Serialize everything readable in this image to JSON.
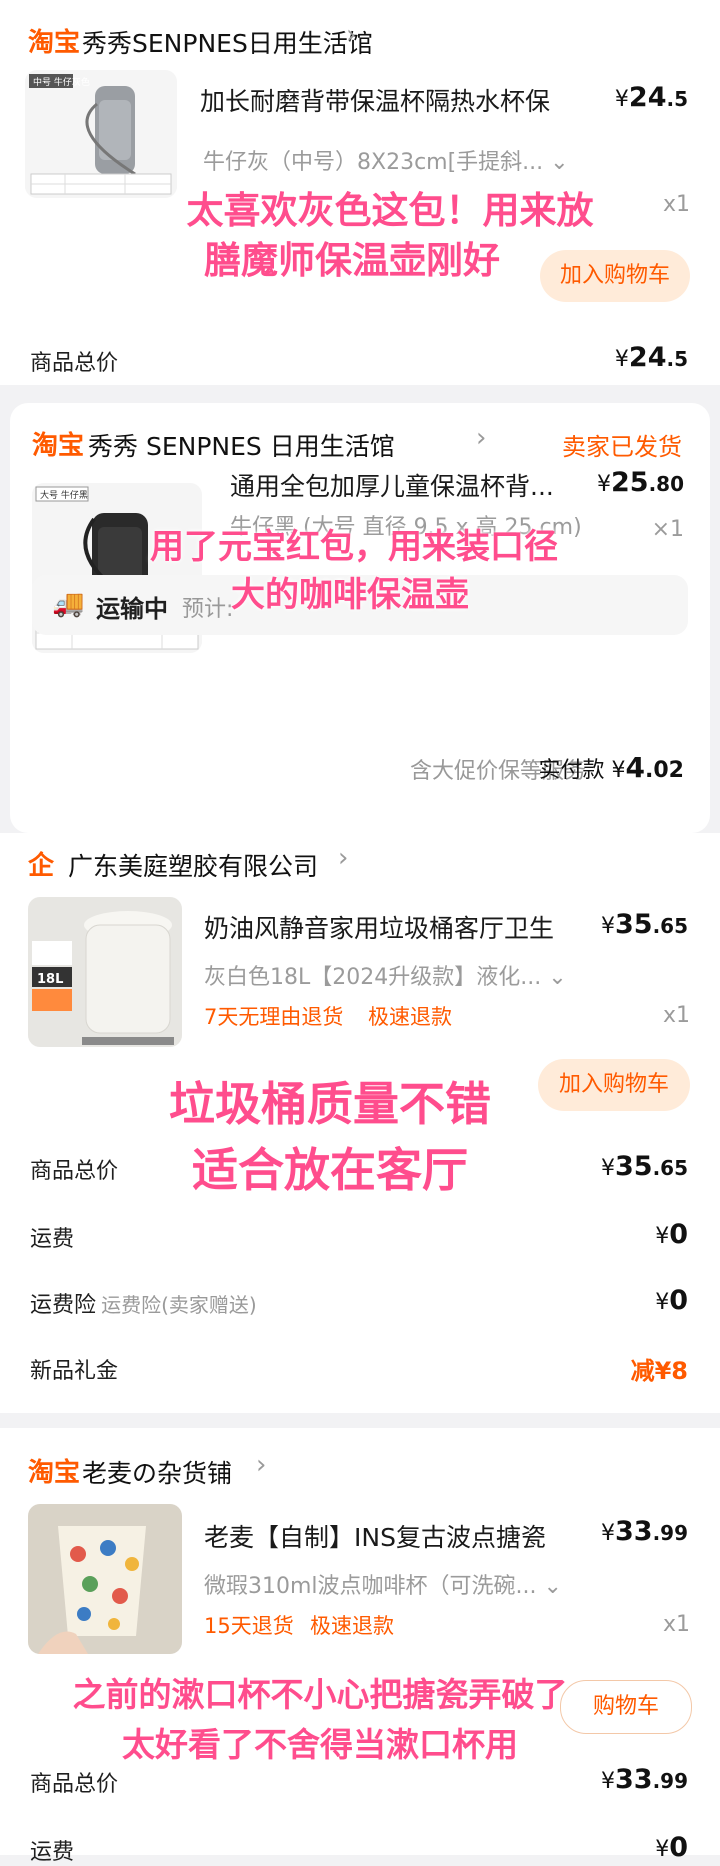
{
  "order1": {
    "store_logo": "淘宝",
    "store_name": "秀秀SENPNES日用生活馆",
    "thumb_badge": "中号 牛仔灰色",
    "title": "加长耐磨背带保温杯隔热水杯保",
    "sku": "牛仔灰（中号）8X23cm[手提斜...",
    "price_symbol": "¥",
    "price_int": "24",
    "price_dec": ".5",
    "qty": "x1",
    "add_cart": "加入购物车",
    "total_label": "商品总价",
    "total_int": "24",
    "total_dec": ".5",
    "overlay_line1": "太喜欢灰色这包！用来放",
    "overlay_line2": "膳魔师保温壶刚好"
  },
  "order2": {
    "store_logo": "淘宝",
    "store_name": "秀秀 SENPNES 日用生活馆",
    "status": "卖家已发货",
    "thumb_badge": "大号 牛仔黑",
    "title": "通用全包加厚儿童保温杯背...",
    "sku": "牛仔黑 (大号 直径 9.5 x 高 25 cm)",
    "price_int": "25",
    "price_dec": ".80",
    "qty": "×1",
    "shipping_status": "运输中",
    "shipping_eta": "预计:",
    "service_note": "含大促价保等服务",
    "paid_label": "实付款",
    "paid_int": "4",
    "paid_dec": ".02",
    "overlay_line1": "用了元宝红包，用来装口径",
    "overlay_line2": "大的咖啡保温壶"
  },
  "order3": {
    "store_logo": "企",
    "store_name": "广东美庭塑胶有限公司",
    "thumb_badge": "18L",
    "title": "奶油风静音家用垃圾桶客厅卫生",
    "sku": "灰白色18L【2024升级款】液化...",
    "price_int": "35",
    "price_dec": ".65",
    "tag1": "7天无理由退货",
    "tag2": "极速退款",
    "qty": "x1",
    "add_cart": "加入购物车",
    "total_label": "商品总价",
    "total_int": "35",
    "total_dec": ".65",
    "shipping_label": "运费",
    "shipping_value": "0",
    "insurance_label": "运费险",
    "insurance_note": "运费险(卖家赠送)",
    "insurance_value": "0",
    "gift_label": "新品礼金",
    "gift_value": "减¥8",
    "overlay_line1": "垃圾桶质量不错",
    "overlay_line2": "适合放在客厅"
  },
  "order4": {
    "store_logo": "淘宝",
    "store_name": "老麦の杂货铺",
    "title": "老麦【自制】INS复古波点搪瓷",
    "sku": "微瑕310ml波点咖啡杯（可洗碗...",
    "price_int": "33",
    "price_dec": ".99",
    "tag1": "15天退货",
    "tag2": "极速退款",
    "qty": "x1",
    "add_cart": "购物车",
    "total_label": "商品总价",
    "total_int": "33",
    "total_dec": ".99",
    "shipping_label": "运费",
    "shipping_value": "0",
    "overlay_line1": "之前的漱口杯不小心把搪瓷弄破了",
    "overlay_line2": "太好看了不舍得当漱口杯用"
  },
  "colors": {
    "accent": "#ff5a00",
    "overlay_pink": "#ff4d8d",
    "background": "#f2f2f4"
  }
}
